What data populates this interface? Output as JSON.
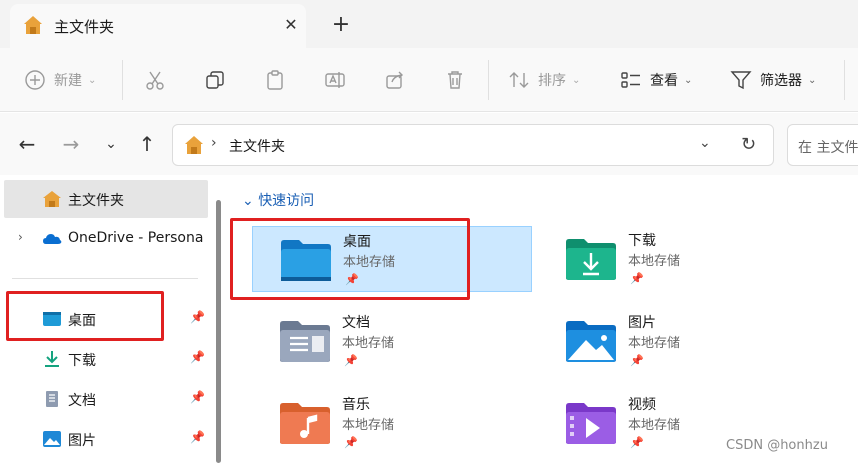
{
  "tab": {
    "title": "主文件夹",
    "close_glyph": "✕",
    "new_tab_glyph": "+"
  },
  "toolbar": {
    "new_label": "新建",
    "sort_label": "排序",
    "view_label": "查看",
    "filter_label": "筛选器",
    "chevron": "⌄"
  },
  "nav": {
    "back": "←",
    "forward": "→",
    "recent": "⌄",
    "up": "↑"
  },
  "address": {
    "crumb_sep": "›",
    "path": "主文件夹",
    "dropdown": "⌄",
    "refresh": "↻"
  },
  "search": {
    "placeholder": "在 主文件夹"
  },
  "sidebar": {
    "items": [
      {
        "label": "主文件夹",
        "icon": "home-icon"
      },
      {
        "label": "OneDrive - Persona",
        "icon": "onedrive-icon",
        "expand": "›"
      },
      {
        "label": "桌面",
        "icon": "desktop-icon",
        "pin": "📌"
      },
      {
        "label": "下载",
        "icon": "download-icon",
        "pin": "📌"
      },
      {
        "label": "文档",
        "icon": "documents-icon",
        "pin": "📌"
      },
      {
        "label": "图片",
        "icon": "pictures-icon",
        "pin": "📌"
      }
    ]
  },
  "main": {
    "section_title": "快速访问",
    "section_chevron": "⌄",
    "tiles": [
      {
        "name": "桌面",
        "sub": "本地存储",
        "icon": "desktop-folder-icon",
        "pin": "📌"
      },
      {
        "name": "下载",
        "sub": "本地存储",
        "icon": "downloads-folder-icon",
        "pin": "📌"
      },
      {
        "name": "文档",
        "sub": "本地存储",
        "icon": "documents-folder-icon",
        "pin": "📌"
      },
      {
        "name": "图片",
        "sub": "本地存储",
        "icon": "pictures-folder-icon",
        "pin": "📌"
      },
      {
        "name": "音乐",
        "sub": "本地存储",
        "icon": "music-folder-icon",
        "pin": "📌"
      },
      {
        "name": "视频",
        "sub": "本地存储",
        "icon": "videos-folder-icon",
        "pin": "📌"
      }
    ]
  },
  "colors": {
    "highlight": "#e02020",
    "selection": "#cce8ff",
    "accent": "#0078d4"
  },
  "watermark": "CSDN @honhzu"
}
